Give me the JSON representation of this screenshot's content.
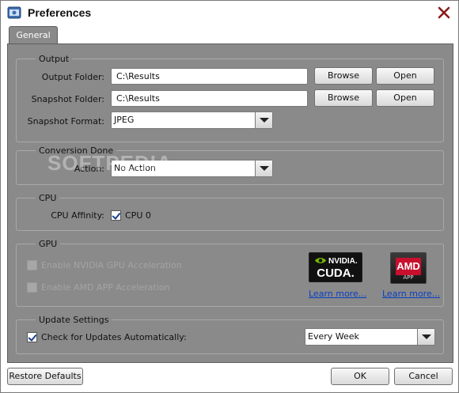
{
  "window": {
    "title": "Preferences"
  },
  "tabs": [
    {
      "label": "General"
    }
  ],
  "output": {
    "legend": "Output",
    "output_folder_label": "Output Folder:",
    "output_folder_value": "C:\\Results",
    "snapshot_folder_label": "Snapshot Folder:",
    "snapshot_folder_value": "C:\\Results",
    "snapshot_format_label": "Snapshot Format:",
    "snapshot_format_value": "JPEG",
    "browse_label": "Browse",
    "open_label": "Open"
  },
  "conversion": {
    "legend": "Conversion Done",
    "action_label": "Action:",
    "action_value": "No Action"
  },
  "cpu": {
    "legend": "CPU",
    "affinity_label": "CPU Affinity:",
    "cpu0_label": "CPU 0",
    "cpu0_checked": true
  },
  "gpu": {
    "legend": "GPU",
    "nvidia_label": "Enable NVIDIA GPU Acceleration",
    "amd_label": "Enable AMD APP Acceleration",
    "nvidia_brand": "NVIDIA.",
    "nvidia_product": "CUDA.",
    "amd_brand": "AMD",
    "amd_product": "APP",
    "learn_more": "Learn more..."
  },
  "update": {
    "legend": "Update Settings",
    "check_label": "Check for Updates Automatically:",
    "check_checked": true,
    "frequency_value": "Every Week"
  },
  "footer": {
    "restore_label": "Restore Defaults",
    "ok_label": "OK",
    "cancel_label": "Cancel"
  },
  "watermark": "SOFTPEDIA",
  "colors": {
    "panel_bg": "#8a8a8a",
    "link": "#0a3fc2",
    "amd_red": "#c8102e"
  }
}
